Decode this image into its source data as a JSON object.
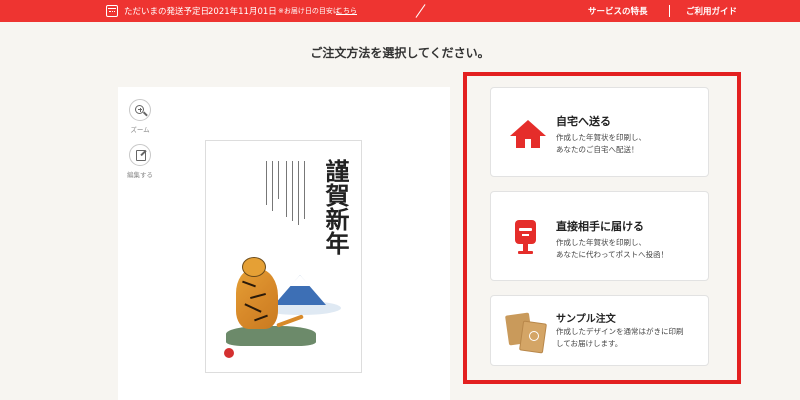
{
  "topbar": {
    "ship_label": "ただいまの発送予定日",
    "ship_date": "2021年11月01日",
    "note": "※お届け日の目安は",
    "note_link": "こちら",
    "nav_features": "サービスの特長",
    "nav_guide": "ご利用ガイド"
  },
  "page_title": "ご注文方法を選択してください。",
  "preview": {
    "zoom_label": "ズーム",
    "edit_label": "編集する",
    "card_title": "謹賀新年"
  },
  "options": [
    {
      "title": "自宅へ送る",
      "desc": "作成した年賀状を印刷し、\nあなたのご自宅へ配送！",
      "icon": "house-icon"
    },
    {
      "title": "直接相手に届ける",
      "desc": "作成した年賀状を印刷し、\nあなたに代わってポストへ投函！",
      "icon": "postbox-icon"
    },
    {
      "title": "サンプル注文",
      "desc": "作成したデザインを通常はがきに印刷\nしてお届けします。",
      "icon": "sample-cards-icon"
    }
  ],
  "colors": {
    "accent": "#ee3431",
    "frame": "#e32020",
    "background": "#f7f5f1"
  }
}
